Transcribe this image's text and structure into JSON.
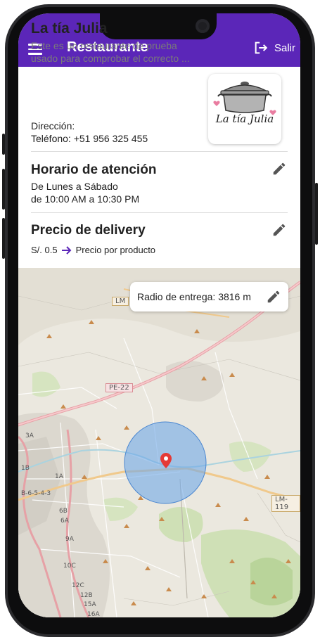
{
  "app_bar": {
    "title": "Restaurante",
    "logout_label": "Salir",
    "color": "#5b26b8"
  },
  "restaurant": {
    "name": "La tía Julia",
    "description_line1": "Este es un restaurante de prueba",
    "description_line2": "usado para comprobar el correcto ...",
    "address": "Dirección:",
    "phone": "Teléfono: +51 956 325 455",
    "logo_text": "La tía Julia"
  },
  "schedule": {
    "title": "Horario de atención",
    "days": "De Lunes a Sábado",
    "hours": "de 10:00 AM a 10:30 PM"
  },
  "delivery": {
    "title": "Precio de delivery",
    "price": "S/. 0.5",
    "price_note": "Precio por producto",
    "arrow_color": "#5b26b8"
  },
  "map": {
    "radius_label": "Radio de entrega: 3816 m",
    "road_labels": [
      "LM",
      "PE-22",
      "LM-119",
      "3A",
      "1B",
      "1A",
      "B-6-5-4-3",
      "6B",
      "6A",
      "9A",
      "10C",
      "12C",
      "12B",
      "15A",
      "16A"
    ],
    "coverage_color": "#6fa8e8",
    "pin_color": "#e53935"
  },
  "icons": {
    "menu": "menu-icon",
    "logout": "logout-icon",
    "edit": "pencil-icon",
    "arrow": "arrow-right-icon",
    "pin": "location-pin-icon"
  }
}
